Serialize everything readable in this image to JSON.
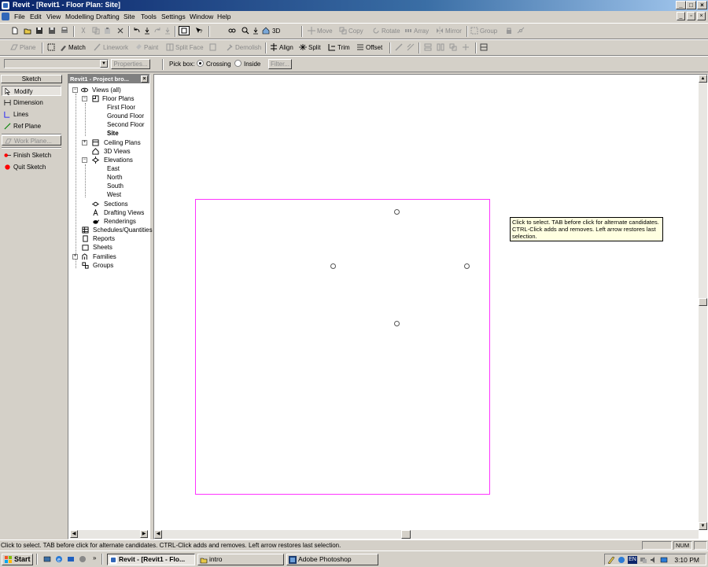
{
  "window": {
    "title": "Revit - [Revit1 - Floor Plan: Site]",
    "controls": [
      "_",
      "□",
      "×"
    ]
  },
  "menu": [
    "File",
    "Edit",
    "View",
    "Modelling",
    "Drafting",
    "Site",
    "Tools",
    "Settings",
    "Window",
    "Help"
  ],
  "toolbar1": {
    "view_3d": "3D",
    "move": "Move",
    "copy": "Copy",
    "rotate": "Rotate",
    "array": "Array",
    "mirror": "Mirror",
    "group": "Group"
  },
  "toolbar2": {
    "plane": "Plane",
    "match": "Match",
    "linework": "Linework",
    "paint": "Paint",
    "split_face": "Split Face",
    "demolish": "Demolish",
    "align": "Align",
    "split": "Split",
    "trim": "Trim",
    "offset": "Offset"
  },
  "options_bar": {
    "type_selector_value": "",
    "properties_label": "Properties...",
    "pick_box_label": "Pick box:",
    "crossing_label": "Crossing",
    "inside_label": "Inside",
    "pick_box_selected": "Crossing",
    "filter_label": "Filter..."
  },
  "sketch_panel": {
    "header": "Sketch",
    "items": [
      "Modify",
      "Dimension",
      "Lines",
      "Ref Plane"
    ],
    "work_plane": "Work Plane...",
    "finish": "Finish Sketch",
    "quit": "Quit Sketch"
  },
  "project_browser": {
    "title": "Revit1 - Project bro...",
    "views_all": "Views (all)",
    "floor_plans": "Floor Plans",
    "floor_plan_items": [
      "First Floor",
      "Ground Floor",
      "Second Floor",
      "Site"
    ],
    "selected_view": "Site",
    "ceiling_plans": "Ceiling Plans",
    "views_3d": "3D Views",
    "elevations": "Elevations",
    "elevation_items": [
      "East",
      "North",
      "South",
      "West"
    ],
    "sections": "Sections",
    "drafting_views": "Drafting Views",
    "renderings": "Renderings",
    "schedules": "Schedules/Quantities",
    "reports": "Reports",
    "sheets": "Sheets",
    "families": "Families",
    "groups": "Groups"
  },
  "tooltip": "Click to select. TAB before click for alternate candidates. CTRL-Click adds and removes. Left arrow restores last selection.",
  "status_bar": {
    "text": "Click to select. TAB before click for alternate candidates. CTRL-Click adds and removes. Left arrow restores last selection.",
    "num": "NUM"
  },
  "taskbar": {
    "start": "Start",
    "tasks": [
      "Revit - [Revit1 - Flo...",
      "intro",
      "Adobe Photoshop"
    ],
    "active_task": "Revit - [Revit1 - Flo...",
    "language": "EN",
    "clock": "3:10 PM"
  },
  "colors": {
    "title_gradient_start": "#0a246a",
    "title_gradient_end": "#a6caf0",
    "site_boundary": "#ff33ff",
    "tooltip_bg": "#ffffe1",
    "finish_sketch_icon": "#ff0000",
    "quit_sketch_icon": "#ff0000"
  }
}
